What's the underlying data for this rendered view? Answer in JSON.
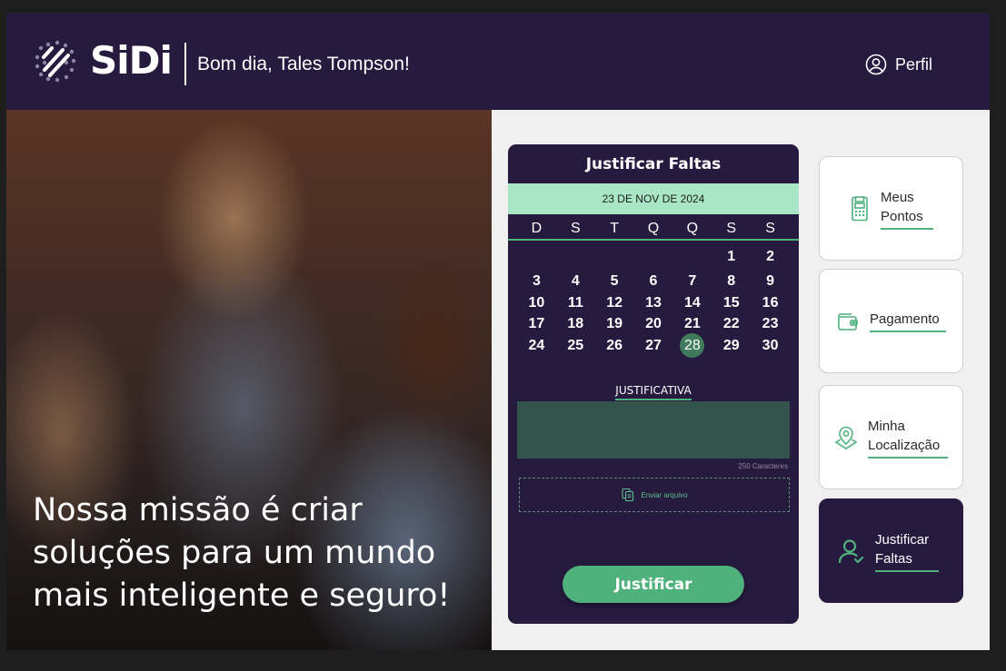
{
  "header": {
    "brand": "SiDi",
    "greeting": "Bom dia, Tales Tompson!",
    "profile_label": "Perfil"
  },
  "hero": {
    "mission": "Nossa missão é criar soluções para um mundo mais inteligente e seguro!"
  },
  "calendar_card": {
    "title": "Justificar Faltas",
    "selected_date": "23 DE NOV DE 2024",
    "weekdays": [
      "D",
      "S",
      "T",
      "Q",
      "Q",
      "S",
      "S"
    ],
    "selected_day": 28,
    "justification_label": "JUSTIFICATIVA",
    "justification_value": "",
    "char_counter": "250 Caracteres",
    "upload_label": "Enviar arquivo",
    "submit_label": "Justificar"
  },
  "menu": {
    "meus_pontos": {
      "line1": "Meus",
      "line2": "Pontos"
    },
    "pagamento": {
      "line1": "Pagamento"
    },
    "localizacao": {
      "line1": "Minha",
      "line2": "Localização"
    },
    "justificar": {
      "line1": "Justificar",
      "line2": "Faltas"
    }
  },
  "colors": {
    "brand_dark": "#271a3f",
    "accent_green": "#4fb17c",
    "date_bar": "#a8e6c6",
    "textarea": "#33544d"
  },
  "icons": {
    "logo": "sidi-logo-icon",
    "profile": "user-circle-icon",
    "upload": "upload-file-icon",
    "pontos": "register-machine-icon",
    "pagamento": "wallet-icon",
    "localizacao": "map-pin-icon",
    "justificar": "user-icon"
  }
}
